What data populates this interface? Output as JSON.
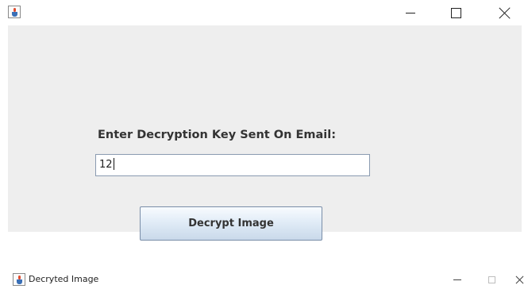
{
  "window1": {
    "title": "",
    "icon": "java-coffee-cup-icon",
    "controls": {
      "minimize": "minimize-icon",
      "maximize": "maximize-icon",
      "close": "close-icon"
    },
    "prompt_label": "Enter Decryption Key Sent On Email:",
    "key_input_value": "12",
    "decrypt_button_label": "Decrypt Image",
    "background_color": "#eeeeee"
  },
  "window2": {
    "title": "Decryted Image",
    "icon": "java-coffee-cup-icon",
    "controls": {
      "minimize": "minimize-icon",
      "maximize": "maximize-icon-disabled",
      "close": "close-icon"
    }
  }
}
